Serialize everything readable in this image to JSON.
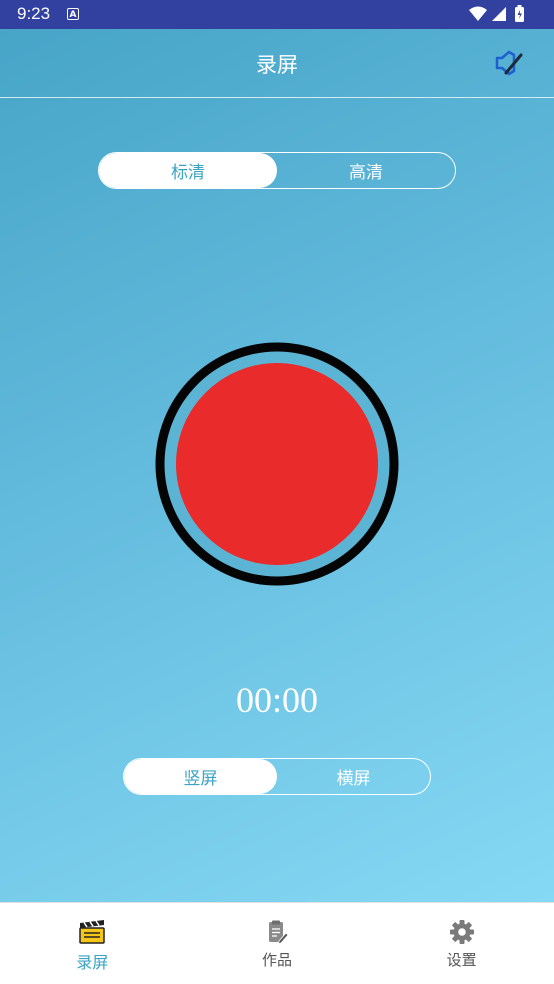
{
  "status_bar": {
    "time": "9:23",
    "notification_icon": "A",
    "icons": [
      "wifi-icon",
      "cell-signal-icon",
      "battery-charging-icon"
    ]
  },
  "header": {
    "title": "录屏",
    "action_icon": "speaker-mute-icon"
  },
  "quality_toggle": {
    "options": [
      "标清",
      "高清"
    ],
    "selected": "标清"
  },
  "record_button": {
    "icon": "record-icon",
    "color": "#e92b2b"
  },
  "timer": "00:00",
  "orientation_toggle": {
    "options": [
      "竖屏",
      "横屏"
    ],
    "selected": "竖屏"
  },
  "bottom_nav": {
    "items": [
      {
        "label": "录屏",
        "icon": "clapperboard-icon",
        "active": true
      },
      {
        "label": "作品",
        "icon": "document-edit-icon",
        "active": false
      },
      {
        "label": "设置",
        "icon": "gear-icon",
        "active": false
      }
    ]
  },
  "colors": {
    "status_bar": "#3240a0",
    "accent": "#3aa3c3",
    "background_start": "#47a5c8",
    "background_end": "#86d9f4"
  }
}
